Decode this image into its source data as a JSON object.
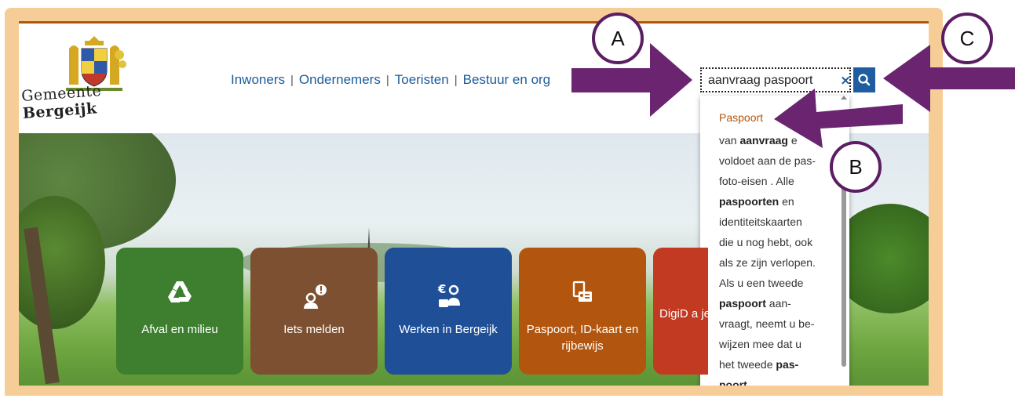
{
  "site": {
    "logo_text_prefix": "Gemeente ",
    "logo_text_bold": "Bergeijk"
  },
  "nav": {
    "items": [
      "Inwoners",
      "Ondernemers",
      "Toeristen",
      "Bestuur en org"
    ],
    "separator": "|"
  },
  "search": {
    "value": "aanvraag paspoort",
    "clear_symbol": "×"
  },
  "suggestion": {
    "title": "Paspoort",
    "lines": [
      [
        {
          "t": "van "
        },
        {
          "t": "aanvraag",
          "b": true
        },
        {
          "t": " e"
        }
      ],
      [
        {
          "t": "voldoet aan de pas-"
        }
      ],
      [
        {
          "t": "foto-eisen . Alle"
        }
      ],
      [
        {
          "t": "paspoorten",
          "b": true
        },
        {
          "t": " en"
        }
      ],
      [
        {
          "t": "identiteitskaarten"
        }
      ],
      [
        {
          "t": "die u nog hebt, ook"
        }
      ],
      [
        {
          "t": "als ze zijn verlopen."
        }
      ],
      [
        {
          "t": "Als u een tweede"
        }
      ],
      [
        {
          "t": "paspoort",
          "b": true
        },
        {
          "t": " aan-"
        }
      ],
      [
        {
          "t": "vraagt, neemt u be-"
        }
      ],
      [
        {
          "t": "wijzen mee dat u"
        }
      ],
      [
        {
          "t": "het tweede "
        },
        {
          "t": "pas-",
          "b": true
        }
      ],
      [
        {
          "t": "poort",
          "b": true
        }
      ]
    ]
  },
  "tiles": [
    {
      "label": "Afval en milieu",
      "icon": "recycle-icon",
      "color": "#3d7f2f"
    },
    {
      "label": "Iets melden",
      "icon": "report-person-icon",
      "color": "#7c5031"
    },
    {
      "label": "Werken in Bergeijk",
      "icon": "euro-worker-icon",
      "color": "#1f5097"
    },
    {
      "label": "Paspoort, ID-kaart en rijbewijs",
      "icon": "passport-id-icon",
      "color": "#b2560f"
    },
    {
      "label": "DigiD a je in he",
      "icon": "digid-icon",
      "color": "#c33a23"
    }
  ],
  "annotations": {
    "badge_a": "A",
    "badge_b": "B",
    "badge_c": "C",
    "arrow_color": "#6a2470",
    "frame_color": "#f6cd97"
  }
}
